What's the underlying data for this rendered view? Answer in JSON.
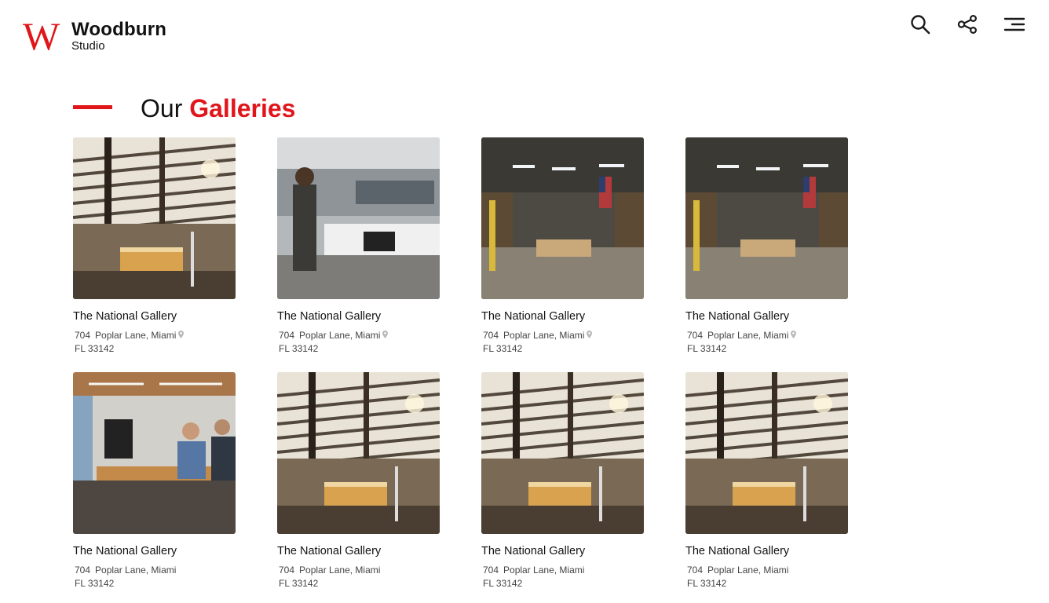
{
  "brand": {
    "mark": "W",
    "name": "Woodburn",
    "sub": "Studio",
    "accent": "#e0161b"
  },
  "nav": {
    "icons": [
      "search-icon",
      "share-icon",
      "menu-icon"
    ]
  },
  "section": {
    "title_part1": "Our",
    "title_part2": "Galleries"
  },
  "galleries": [
    {
      "title": "The National Gallery",
      "street_no": "704",
      "street": "Poplar Lane, Miami",
      "zip": "FL 33142",
      "image": "sunny-studio"
    },
    {
      "title": "The National Gallery",
      "street_no": "704",
      "street": "Poplar Lane, Miami",
      "zip": "FL 33142",
      "image": "open-office"
    },
    {
      "title": "The National Gallery",
      "street_no": "704",
      "street": "Poplar Lane, Miami",
      "zip": "FL 33142",
      "image": "workshop"
    },
    {
      "title": "The National Gallery",
      "street_no": "704",
      "street": "Poplar Lane, Miami",
      "zip": "FL 33142",
      "image": "workshop"
    },
    {
      "title": "The National Gallery",
      "street_no": "704",
      "street": "Poplar Lane, Miami",
      "zip": "FL 33142",
      "image": "coworking"
    },
    {
      "title": "The National Gallery",
      "street_no": "704",
      "street": "Poplar Lane, Miami",
      "zip": "FL 33142",
      "image": "sunny-studio"
    },
    {
      "title": "The National Gallery",
      "street_no": "704",
      "street": "Poplar Lane, Miami",
      "zip": "FL 33142",
      "image": "sunny-studio"
    },
    {
      "title": "The National Gallery",
      "street_no": "704",
      "street": "Poplar Lane, Miami",
      "zip": "FL 33142",
      "image": "sunny-studio"
    }
  ]
}
